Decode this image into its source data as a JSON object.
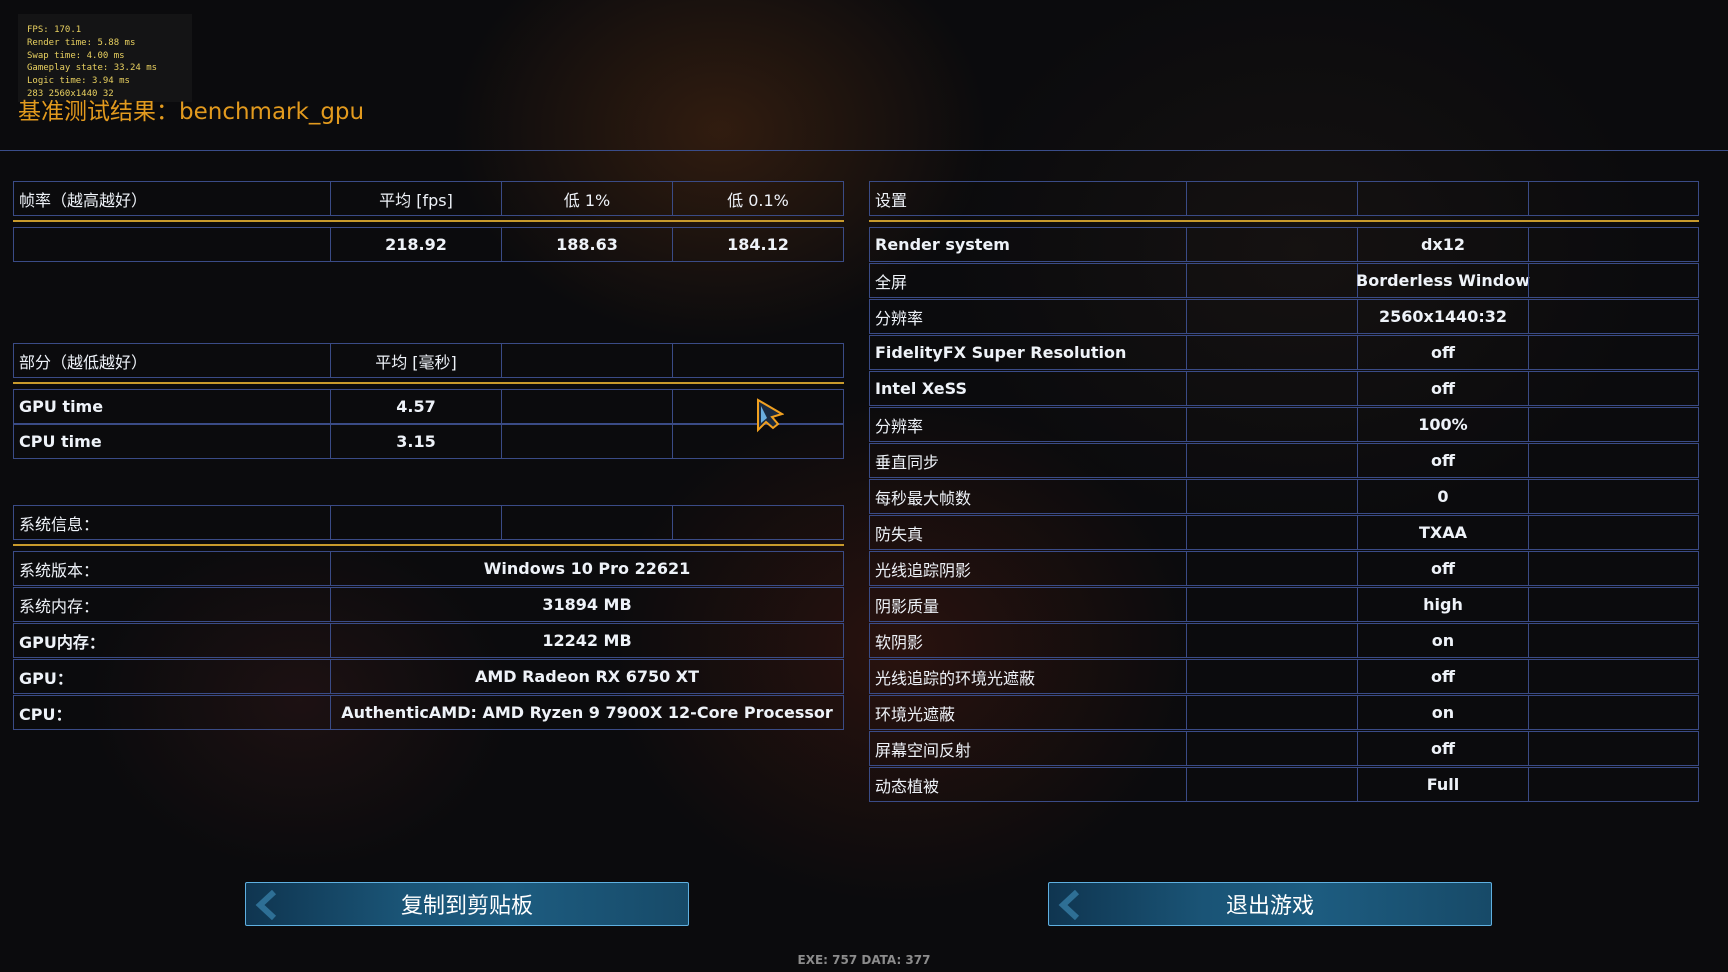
{
  "overlay": {
    "lines": [
      "FPS: 170.1",
      "Render time: 5.88 ms",
      "Swap time: 4.00 ms",
      "Gameplay state: 33.24 ms",
      "Logic time: 3.94 ms",
      "283 2560x1440 32"
    ]
  },
  "title": "基准测试结果：benchmark_gpu",
  "fps_table": {
    "headers": [
      "帧率（越高越好）",
      "平均 [fps]",
      "低 1%",
      "低 0.1%"
    ],
    "values": [
      "",
      "218.92",
      "188.63",
      "184.12"
    ]
  },
  "part_table": {
    "headers": [
      "部分（越低越好）",
      "平均 [毫秒]",
      "",
      ""
    ],
    "rows": [
      {
        "label": "GPU time",
        "value": "4.57"
      },
      {
        "label": "CPU time",
        "value": "3.15"
      }
    ]
  },
  "sys_table": {
    "header": "系统信息：",
    "rows": [
      {
        "label": "系统版本：",
        "value": "Windows 10 Pro 22621"
      },
      {
        "label": "系统内存：",
        "value": "31894 MB"
      },
      {
        "label": "GPU内存：",
        "value": "12242 MB"
      },
      {
        "label": "GPU：",
        "value": "AMD Radeon RX 6750 XT"
      },
      {
        "label": "CPU：",
        "value": "AuthenticAMD: AMD Ryzen 9 7900X 12-Core Processor"
      }
    ]
  },
  "settings_table": {
    "header": "设置",
    "rows": [
      {
        "label": "Render system",
        "value": "dx12"
      },
      {
        "label": "全屏",
        "value": "Borderless Window"
      },
      {
        "label": "分辨率",
        "value": "2560x1440:32"
      },
      {
        "label": "FidelityFX Super Resolution",
        "value": "off"
      },
      {
        "label": "Intel XeSS",
        "value": "off"
      },
      {
        "label": "分辨率",
        "value": "100%"
      },
      {
        "label": "垂直同步",
        "value": "off"
      },
      {
        "label": "每秒最大帧数",
        "value": "0"
      },
      {
        "label": "防失真",
        "value": "TXAA"
      },
      {
        "label": "光线追踪阴影",
        "value": "off"
      },
      {
        "label": "阴影质量",
        "value": "high"
      },
      {
        "label": "软阴影",
        "value": "on"
      },
      {
        "label": "光线追踪的环境光遮蔽",
        "value": "off"
      },
      {
        "label": "环境光遮蔽",
        "value": "on"
      },
      {
        "label": "屏幕空间反射",
        "value": "off"
      },
      {
        "label": "动态植被",
        "value": "Full"
      }
    ]
  },
  "buttons": {
    "copy": "复制到剪贴板",
    "exit": "退出游戏"
  },
  "footer": "EXE: 757 DATA: 377",
  "colors": {
    "title": "#e29a1e",
    "divider": "#c89a2c",
    "border": "#3a4b86",
    "button": "#1a5476"
  }
}
